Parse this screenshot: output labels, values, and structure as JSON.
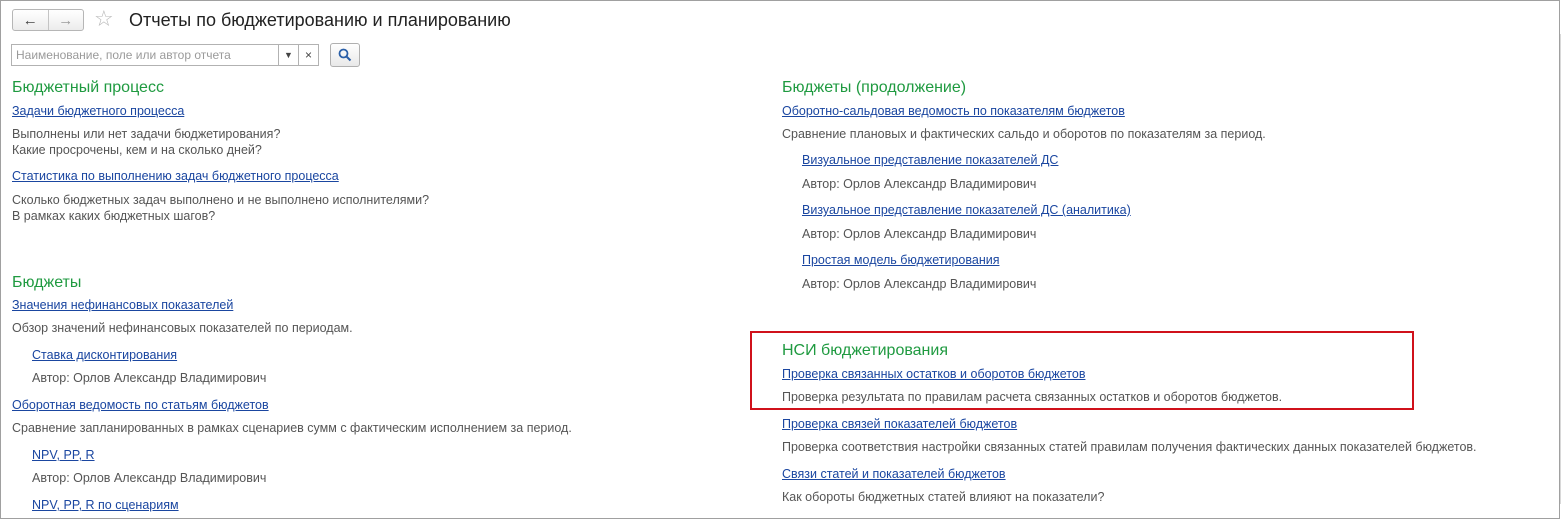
{
  "header": {
    "back_icon": "arrow-left-icon",
    "forward_icon": "arrow-right-icon",
    "favorite_icon": "star-icon",
    "title": "Отчеты по бюджетированию и планированию"
  },
  "search": {
    "placeholder": "Наименование, поле или автор отчета",
    "value": "",
    "dropdown_icon": "chevron-down-icon",
    "clear_icon": "close-icon",
    "find_icon": "search-icon"
  },
  "colors": {
    "section_title": "#1f9a40",
    "link": "#1a46a0",
    "highlight_border": "#d0111b"
  },
  "left_column": {
    "budget_process": {
      "title": "Бюджетный процесс",
      "items": [
        {
          "link": "Задачи бюджетного процесса",
          "desc": [
            "Выполнены или нет задачи бюджетирования?",
            "Какие просрочены, кем и на сколько дней?"
          ]
        },
        {
          "link": "Статистика по выполнению задач бюджетного процесса",
          "desc": [
            "Сколько бюджетных задач выполнено и не выполнено исполнителями?",
            "В рамках каких бюджетных шагов?"
          ]
        }
      ]
    },
    "budgets": {
      "title": "Бюджеты",
      "items": [
        {
          "link": "Значения нефинансовых показателей",
          "desc": "Обзор значений нефинансовых показателей по периодам."
        },
        {
          "link": "Ставка дисконтирования",
          "author": "Автор: Орлов Александр Владимирович"
        },
        {
          "link": "Оборотная ведомость по статьям бюджетов",
          "desc": "Сравнение запланированных в рамках сценариев сумм с фактическим исполнением за период."
        },
        {
          "link": "NPV, PP, R",
          "author": "Автор: Орлов Александр Владимирович"
        },
        {
          "link": "NPV, PP, R по сценариям"
        }
      ]
    }
  },
  "right_column": {
    "budgets_cont": {
      "title": "Бюджеты (продолжение)",
      "items": [
        {
          "link": "Оборотно-сальдовая ведомость по показателям бюджетов",
          "desc": "Сравнение плановых и фактических сальдо и оборотов по показателям за период."
        },
        {
          "link": "Визуальное представление показателей ДС",
          "author": "Автор: Орлов Александр Владимирович"
        },
        {
          "link": "Визуальное представление показателей ДС (аналитика)",
          "author": "Автор: Орлов Александр Владимирович"
        },
        {
          "link": "Простая модель бюджетирования",
          "author": "Автор: Орлов Александр Владимирович"
        }
      ]
    },
    "nsi": {
      "title": "НСИ бюджетирования",
      "items": [
        {
          "link": "Проверка связанных остатков и оборотов бюджетов",
          "desc": "Проверка результата по правилам расчета связанных остатков и оборотов бюджетов."
        },
        {
          "link": "Проверка связей показателей бюджетов",
          "desc": "Проверка соответствия настройки связанных статей правилам получения фактических данных показателей бюджетов."
        },
        {
          "link": "Связи статей и показателей бюджетов",
          "desc": "Как обороты бюджетных статей влияют на показатели?"
        }
      ]
    }
  }
}
